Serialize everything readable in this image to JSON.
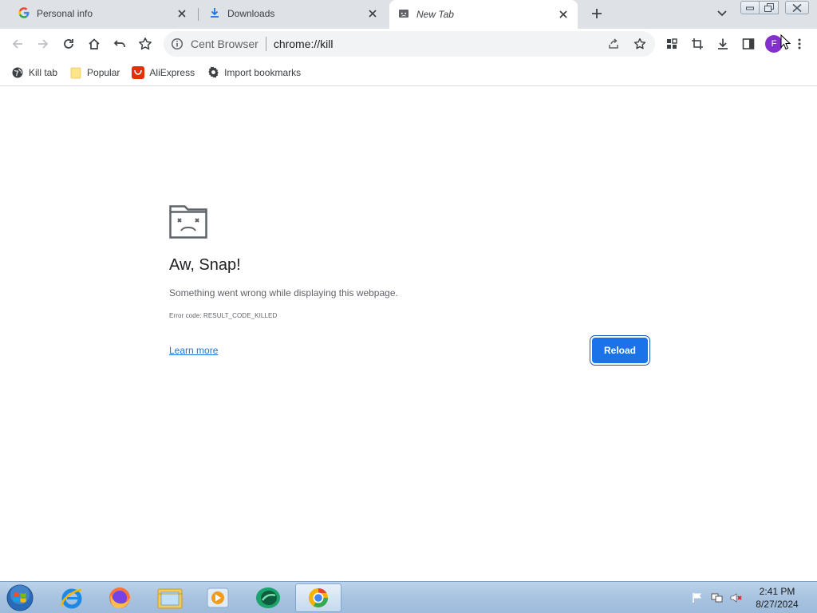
{
  "tabs": [
    {
      "title": "Personal info",
      "icon": "google-g-icon"
    },
    {
      "title": "Downloads",
      "icon": "download-icon"
    },
    {
      "title": "New Tab",
      "icon": "sad-tab-icon",
      "active": true
    }
  ],
  "omnibox": {
    "label": "Cent Browser",
    "url": "chrome://kill"
  },
  "profile": {
    "initial": "F",
    "color": "#8430ce"
  },
  "bookmarks": [
    {
      "label": "Kill tab",
      "icon": "globe-icon"
    },
    {
      "label": "Popular",
      "icon": "folder-icon"
    },
    {
      "label": "AliExpress",
      "icon": "aliexpress-icon"
    },
    {
      "label": "Import bookmarks",
      "icon": "gear-icon"
    }
  ],
  "error": {
    "title": "Aw, Snap!",
    "message": "Something went wrong while displaying this webpage.",
    "code": "Error code: RESULT_CODE_KILLED",
    "learn_more": "Learn more",
    "reload": "Reload"
  },
  "taskbar": {
    "apps": [
      "internet-explorer-icon",
      "firefox-icon",
      "file-explorer-icon",
      "media-player-icon",
      "green-app-icon",
      "cent-browser-icon"
    ],
    "time": "2:41 PM",
    "date": "8/27/2024"
  },
  "colors": {
    "accent": "#1a73e8",
    "tabstrip": "#dee1e6"
  }
}
